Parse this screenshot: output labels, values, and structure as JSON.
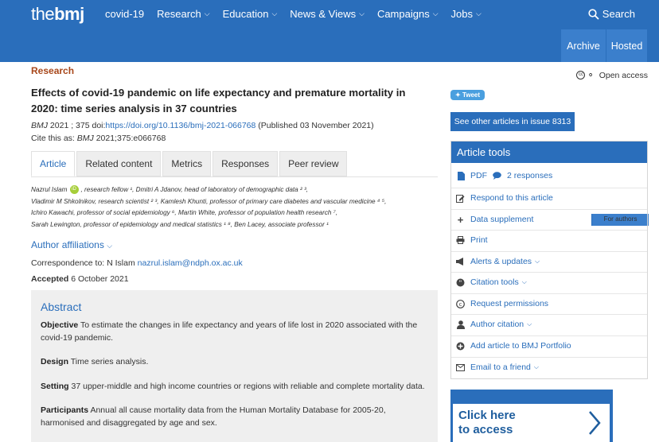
{
  "header": {
    "logo_prefix": "the",
    "logo_main": "bmj",
    "nav": [
      {
        "label": "covid-19",
        "dropdown": false
      },
      {
        "label": "Research",
        "dropdown": true
      },
      {
        "label": "Education",
        "dropdown": true
      },
      {
        "label": "News & Views",
        "dropdown": true
      },
      {
        "label": "Campaigns",
        "dropdown": true
      },
      {
        "label": "Jobs",
        "dropdown": true
      }
    ],
    "search_label": "Search",
    "subnav": [
      "Archive",
      "For authors",
      "Hosted"
    ]
  },
  "article": {
    "section": "Research",
    "title": "Effects of covid-19 pandemic on life expectancy and premature mortality in 2020: time series analysis in 37 countries",
    "journal": "BMJ",
    "year_vol": "2021 ; 375",
    "doi_label": "doi:",
    "doi_url": "https://doi.org/10.1136/bmj-2021-066768",
    "published": "(Published 03 November 2021)",
    "cite_prefix": "Cite this as:",
    "cite_journal": "BMJ",
    "cite_ref": "2021;375:e066768",
    "tabs": [
      "Article",
      "Related content",
      "Metrics",
      "Responses",
      "Peer review"
    ],
    "authors_lines": [
      {
        "name": "Nazrul Islam",
        "rest": ", research fellow ¹,  Dmitri A Jdanov, head of laboratory of demographic data ² ³,"
      },
      {
        "name": "Vladimir M Shkolnikov",
        "rest": ", research scientist ² ³,  Kamlesh Khunti, professor of primary care diabetes and vascular medicine ⁴ ⁵,"
      },
      {
        "name": "Ichiro Kawachi",
        "rest": ", professor of social epidemiology ⁶,  Martin White, professor of population health research ⁷,"
      },
      {
        "name": "Sarah Lewington",
        "rest": ", professor of epidemiology and medical statistics ¹ ⁸,  Ben Lacey, associate professor ¹"
      }
    ],
    "orcid_badge": "iD",
    "affiliations_label": "Author affiliations",
    "correspondence_label": "Correspondence to: N Islam",
    "correspondence_email": "nazrul.islam@ndph.ox.ac.uk",
    "accepted_label": "Accepted",
    "accepted_date": "6 October 2021",
    "abstract": {
      "title": "Abstract",
      "sections": [
        {
          "head": "Objective",
          "text": "To estimate the changes in life expectancy and years of life lost in 2020 associated with the covid-19 pandemic."
        },
        {
          "head": "Design",
          "text": "Time series analysis."
        },
        {
          "head": "Setting",
          "text": "37 upper-middle and high income countries or regions with reliable and complete mortality data."
        },
        {
          "head": "Participants",
          "text": "Annual all cause mortality data from the Human Mortality Database for 2005-20, harmonised and disaggregated by age and sex."
        }
      ]
    }
  },
  "sidebar": {
    "open_access": "Open access",
    "tweet": "Tweet",
    "issue_button": "See other articles in issue 8313",
    "tools_title": "Article tools",
    "tools": [
      {
        "label": "PDF",
        "icon": "pdf-icon",
        "extra": "2 responses",
        "extra_icon": "comment-icon"
      },
      {
        "label": "Respond to this article",
        "icon": "edit-icon"
      },
      {
        "label": "Data supplement",
        "icon": "plus-icon"
      },
      {
        "label": "Print",
        "icon": "print-icon"
      },
      {
        "label": "Alerts & updates",
        "icon": "megaphone-icon",
        "dropdown": true
      },
      {
        "label": "Citation tools",
        "icon": "quote-icon",
        "dropdown": true
      },
      {
        "label": "Request permissions",
        "icon": "copyright-icon"
      },
      {
        "label": "Author citation",
        "icon": "user-icon",
        "dropdown": true
      },
      {
        "label": "Add article to BMJ Portfolio",
        "icon": "add-circle-icon"
      },
      {
        "label": "Email to a friend",
        "icon": "envelope-icon",
        "dropdown": true
      }
    ],
    "ad_line1": "Click here",
    "ad_line2": "to access"
  }
}
